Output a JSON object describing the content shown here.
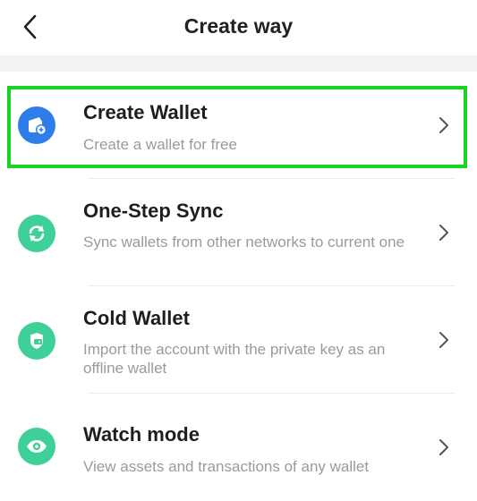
{
  "header": {
    "title": "Create way",
    "back_icon": "chevron-left-icon"
  },
  "colors": {
    "blue_accent": "#2f7de9",
    "green_accent": "#3fcf98",
    "highlight": "#17d421"
  },
  "items": [
    {
      "title": "Create Wallet",
      "desc": "Create a wallet for free",
      "icon": "wallet-add-icon"
    },
    {
      "title": "One-Step Sync",
      "desc": "Sync wallets from other networks to current one",
      "icon": "sync-icon"
    },
    {
      "title": "Cold Wallet",
      "desc": "Import the account with the private key as an offline wallet",
      "icon": "shield-icon"
    },
    {
      "title": "Watch mode",
      "desc": "View assets and transactions of any wallet",
      "icon": "eye-icon"
    }
  ]
}
